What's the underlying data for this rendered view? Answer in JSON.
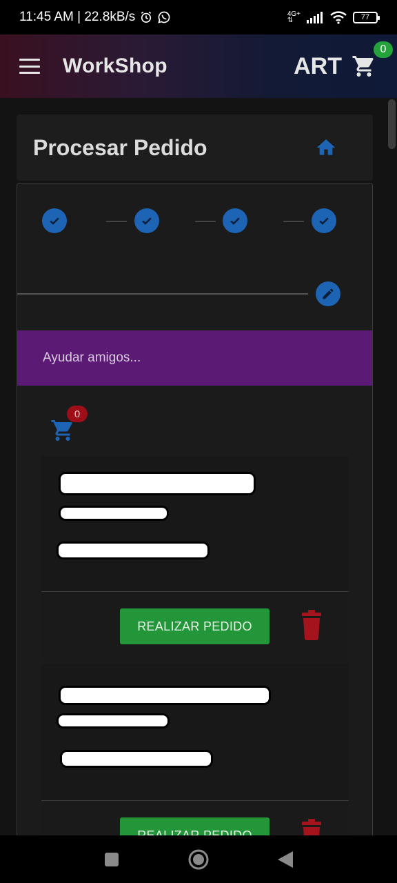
{
  "status_bar": {
    "time_speed": "11:45 AM | 22.8kB/s",
    "network_label": "4G+",
    "battery": "77",
    "icons": [
      "alarm-icon",
      "whatsapp-icon",
      "signal-icon",
      "wifi-icon",
      "battery-icon"
    ]
  },
  "app_bar": {
    "title": "WorkShop",
    "brand": "ART",
    "cart_count": "0"
  },
  "header": {
    "title": "Procesar Pedido"
  },
  "stepper": {
    "steps_completed": 4
  },
  "help_banner": {
    "text": "Ayudar amigos..."
  },
  "mini_cart": {
    "count": "0"
  },
  "orders": [
    {
      "action_label": "REALIZAR PEDIDO"
    },
    {
      "action_label": "REALIZAR PEDIDO"
    }
  ],
  "colors": {
    "accent_blue": "#1d65b4",
    "banner_purple": "#5b1b75",
    "order_green": "#23963a",
    "delete_red": "#a5141d",
    "cart_badge_green": "#23a33a"
  }
}
